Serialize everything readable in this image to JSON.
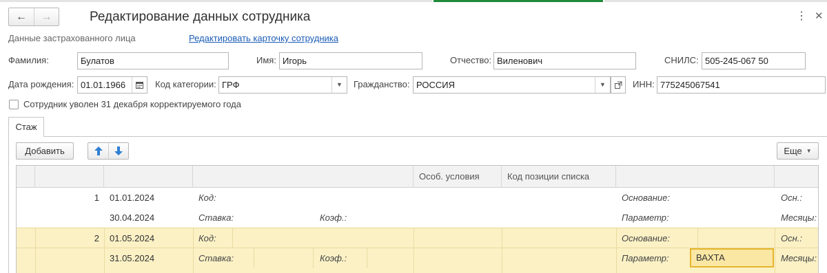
{
  "window": {
    "title": "Редактирование данных сотрудника",
    "subtitle": "Данные застрахованного лица",
    "edit_card_link": "Редактировать карточку сотрудника"
  },
  "form": {
    "surname_label": "Фамилия:",
    "surname": "Булатов",
    "name_label": "Имя:",
    "name": "Игорь",
    "patronymic_label": "Отчество:",
    "patronymic": "Виленович",
    "snils_label": "СНИЛС:",
    "snils": "505-245-067 50",
    "birth_date_label": "Дата рождения:",
    "birth_date": "01.01.1966",
    "category_label": "Код категории:",
    "category": "ГРФ",
    "citizenship_label": "Гражданство:",
    "citizenship": "РОССИЯ",
    "inn_label": "ИНН:",
    "inn": "775245067541",
    "dismissed_label": "Сотрудник уволен 31 декабря корректируемого года"
  },
  "tabs": [
    "Стаж"
  ],
  "toolbar": {
    "add_label": "Добавить",
    "more_label": "Еще"
  },
  "table": {
    "headers": {
      "special_conditions": "Особ. условия",
      "list_position_code": "Код позиции списка"
    },
    "labels": {
      "code": "Код:",
      "rate": "Ставка:",
      "coef": "Коэф.:",
      "basis": "Основание:",
      "param": "Параметр:",
      "osn": "Осн.:",
      "months": "Месяцы:"
    },
    "rows": [
      {
        "num": "1",
        "date_from": "01.01.2024",
        "date_to": "30.04.2024",
        "param_value": ""
      },
      {
        "num": "2",
        "date_from": "01.05.2024",
        "date_to": "31.05.2024",
        "param_value": "ВАХТА"
      }
    ]
  }
}
